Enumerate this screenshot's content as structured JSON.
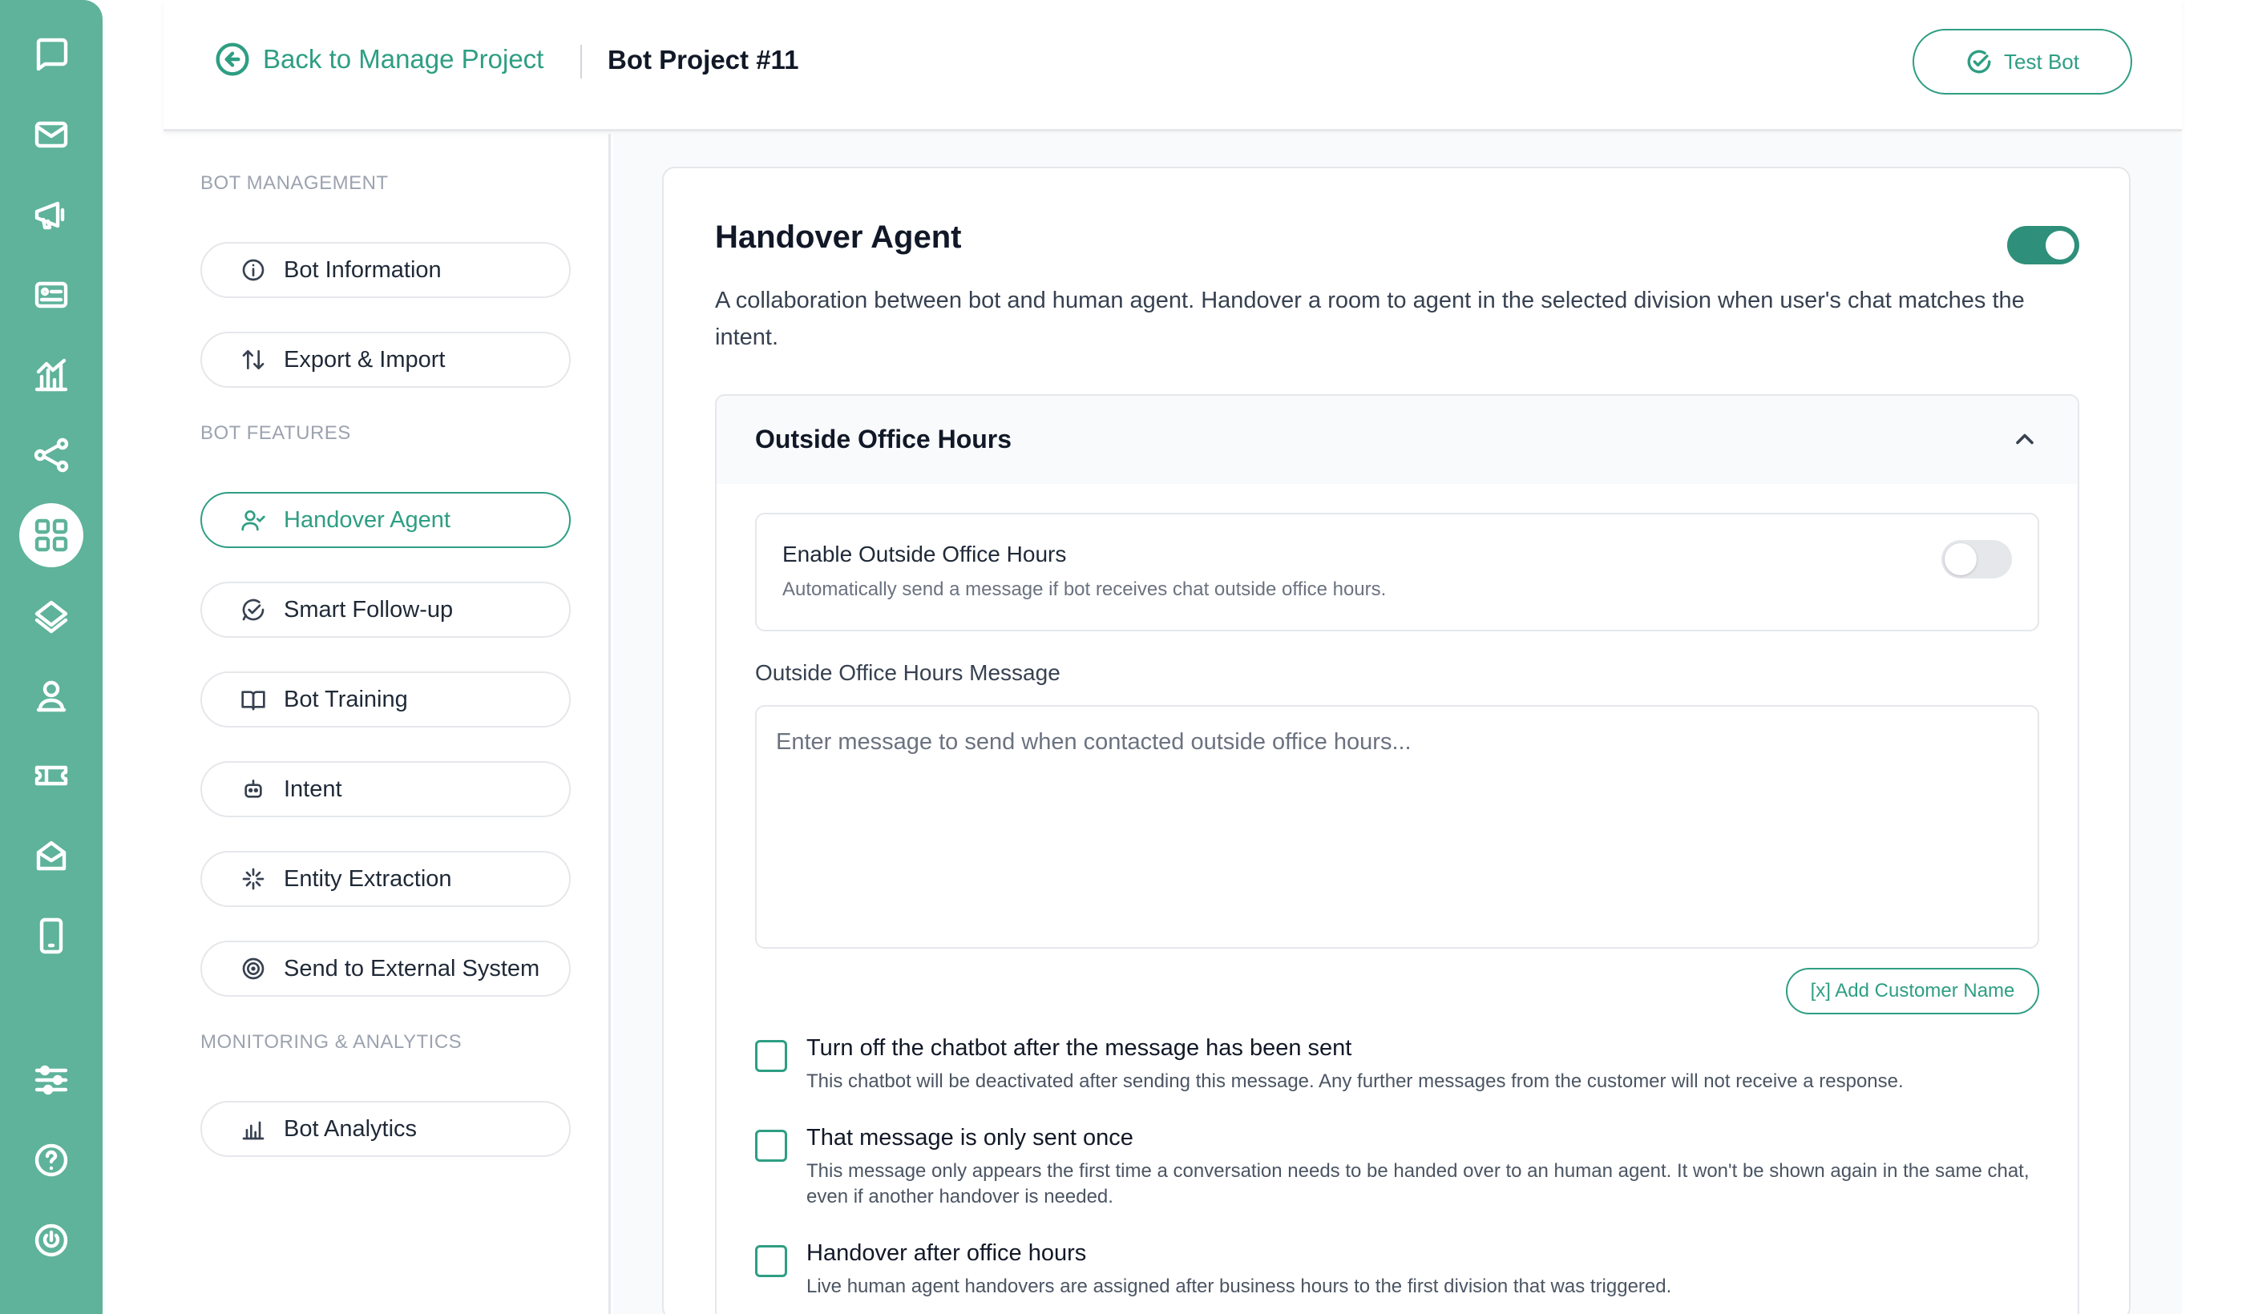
{
  "header": {
    "back_label": "Back to Manage Project",
    "project_title": "Bot Project #11",
    "test_bot_label": "Test Bot"
  },
  "rail": {
    "icons": [
      "chat-logo-icon",
      "mail-icon",
      "megaphone-icon",
      "contact-card-icon",
      "analytics-icon",
      "flow-icon",
      "apps-icon",
      "broadcast-icon",
      "agent-icon",
      "ticket-icon",
      "inbox-icon",
      "mobile-icon",
      "settings-sliders-icon",
      "help-icon",
      "power-icon"
    ]
  },
  "sidebar": {
    "sections": [
      {
        "label": "BOT MANAGEMENT"
      },
      {
        "label": "BOT FEATURES"
      },
      {
        "label": "MONITORING & ANALYTICS"
      }
    ],
    "items": [
      {
        "label": "Bot Information",
        "icon": "info-icon"
      },
      {
        "label": "Export & Import",
        "icon": "swap-icon"
      },
      {
        "label": "Handover Agent",
        "icon": "user-check-icon",
        "active": true
      },
      {
        "label": "Smart Follow-up",
        "icon": "chat-check-icon"
      },
      {
        "label": "Bot Training",
        "icon": "book-icon"
      },
      {
        "label": "Intent",
        "icon": "robot-icon"
      },
      {
        "label": "Entity Extraction",
        "icon": "sparkle-icon"
      },
      {
        "label": "Send to External System",
        "icon": "target-icon"
      },
      {
        "label": "Bot Analytics",
        "icon": "bar-chart-icon"
      }
    ]
  },
  "main": {
    "title": "Handover Agent",
    "enabled": true,
    "description": "A collaboration between bot and human agent. Handover a room to agent in the selected division when user's chat matches the intent.",
    "accordion": {
      "title": "Outside Office Hours",
      "enable_title": "Enable Outside Office Hours",
      "enable_sub": "Automatically send a message if bot receives chat outside office hours.",
      "enable_on": false,
      "message_label": "Outside Office Hours Message",
      "message_placeholder": "Enter message to send when contacted outside office hours...",
      "add_name_label": "[x] Add Customer Name",
      "options": [
        {
          "title": "Turn off the chatbot after the message has been sent",
          "desc": "This chatbot will be deactivated after sending this message. Any further messages from the customer will not receive a response."
        },
        {
          "title": "That message is only sent once",
          "desc": "This message only appears the first time a conversation needs to be handed over to an human agent. It won't be shown again in the same chat, even if another handover is needed."
        },
        {
          "title": "Handover after office hours",
          "desc": "Live human agent handovers are assigned after business hours to the first division that was triggered."
        }
      ]
    }
  },
  "colors": {
    "rail": "#5eb39a",
    "accent": "#2e9e83",
    "toggle_on": "#2e8f7a"
  }
}
